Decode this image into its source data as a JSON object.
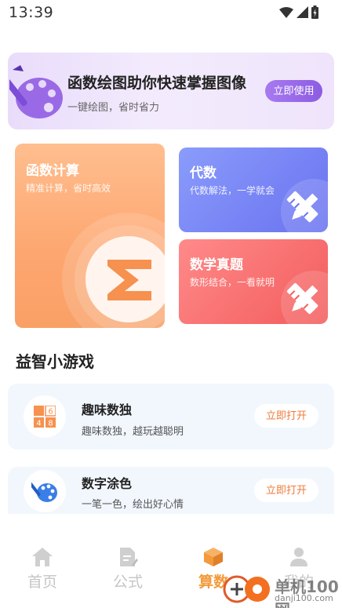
{
  "status_bar": {
    "time": "13:39"
  },
  "banner": {
    "title": "函数绘图助你快速掌握图像",
    "subtitle": "一键绘图，省时省力",
    "button": "立即使用"
  },
  "cards": {
    "calc": {
      "title": "函数计算",
      "subtitle": "精准计算，省时高效"
    },
    "algebra": {
      "title": "代数",
      "subtitle": "代数解法，一学就会"
    },
    "exam": {
      "title": "数学真题",
      "subtitle": "数形结合，一看就明"
    }
  },
  "games_section": {
    "title": "益智小游戏",
    "items": [
      {
        "name": "趣味数独",
        "desc": "趣味数独，越玩越聪明",
        "button": "立即打开",
        "sudoku_digits": [
          "6",
          "4",
          "8"
        ]
      },
      {
        "name": "数字涂色",
        "desc": "一笔一色，绘出好心情",
        "button": "立即打开"
      }
    ]
  },
  "bottom_nav": {
    "items": [
      {
        "label": "首页",
        "icon": "home-icon"
      },
      {
        "label": "公式",
        "icon": "formula-document-icon"
      },
      {
        "label": "算数",
        "icon": "cube-icon",
        "active": true
      },
      {
        "label": "我的",
        "icon": "person-icon"
      }
    ]
  },
  "watermark": {
    "text": "单机100网",
    "url": "danji100.com"
  },
  "colors": {
    "accent_orange": "#f39a3c",
    "banner_button": "#8c5ce2",
    "algebra_card": "#6a72f0",
    "exam_card": "#f35c5c",
    "calc_card": "#fda66f"
  }
}
